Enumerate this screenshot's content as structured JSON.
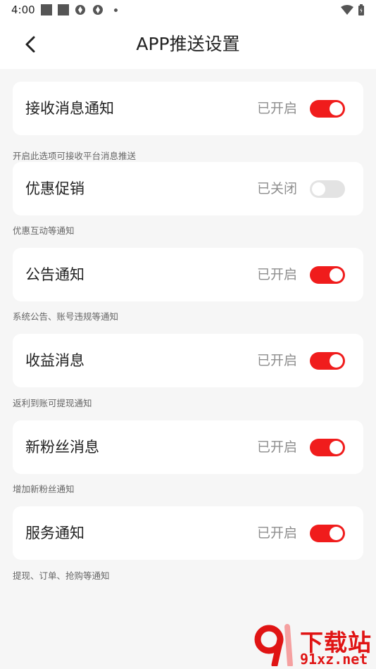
{
  "status_bar": {
    "time": "4:00",
    "icons": [
      "square-icon",
      "square-icon",
      "aperture-icon",
      "aperture-icon",
      "dot-icon",
      "wifi-icon",
      "battery-icon"
    ]
  },
  "header": {
    "title": "APP推送设置",
    "back_icon": "chevron-left-icon"
  },
  "settings": [
    {
      "label": "接收消息通知",
      "state": "已开启",
      "enabled": true,
      "description": "开启此选项可接收平台消息推送"
    },
    {
      "label": "优惠促销",
      "state": "已关闭",
      "enabled": false,
      "description": "优惠互动等通知"
    },
    {
      "label": "公告通知",
      "state": "已开启",
      "enabled": true,
      "description": "系统公告、账号违规等通知"
    },
    {
      "label": "收益消息",
      "state": "已开启",
      "enabled": true,
      "description": "返利到账可提现通知"
    },
    {
      "label": "新粉丝消息",
      "state": "已开启",
      "enabled": true,
      "description": "增加新粉丝通知"
    },
    {
      "label": "服务通知",
      "state": "已开启",
      "enabled": true,
      "description": "提现、订单、抢购等通知"
    }
  ],
  "colors": {
    "accent": "#f01c1c",
    "toggle_off": "#e3e3e3",
    "background": "#f6f6f6",
    "card": "#ffffff"
  },
  "watermark": {
    "brand_cn": "下载站",
    "url": "91xz.net"
  }
}
